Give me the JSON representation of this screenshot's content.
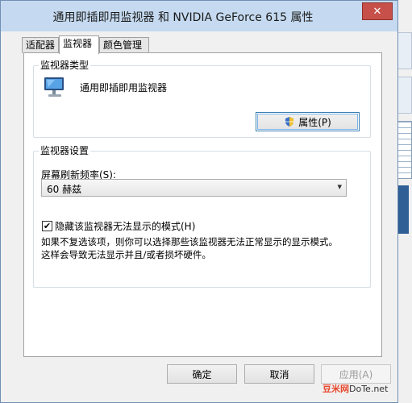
{
  "window": {
    "title": "通用即插即用监视器 和 NVIDIA GeForce 615 属性",
    "close_glyph": "✕"
  },
  "tabs": [
    {
      "label": "适配器"
    },
    {
      "label": "监视器",
      "active": true
    },
    {
      "label": "颜色管理"
    }
  ],
  "monitor_type": {
    "group_title": "监视器类型",
    "monitor_name": "通用即插即用监视器",
    "properties_button": "属性(P)",
    "properties_icon": "shield-icon"
  },
  "monitor_settings": {
    "group_title": "监视器设置",
    "refresh_label": "屏幕刷新频率(S):",
    "refresh_value": "60 赫兹",
    "hide_modes_label": "隐藏该监视器无法显示的模式(H)",
    "hide_modes_checked": true,
    "description_line1": "如果不复选该项，则你可以选择那些该监视器无法正常显示的显示模式。",
    "description_line2": "这样会导致无法显示并且/或者损坏硬件。"
  },
  "footer": {
    "ok_label": "确定",
    "cancel_label": "取消",
    "apply_label": "应用(A)"
  },
  "watermark": {
    "brand_red": "豆米网",
    "brand_dark": "DoTe",
    "suffix": ".net"
  },
  "colors": {
    "titlebar": "#c5daf0",
    "dialog_bg": "#f0f0f0",
    "close_button": "#c7504a",
    "focus_border": "#3c7fb1"
  }
}
